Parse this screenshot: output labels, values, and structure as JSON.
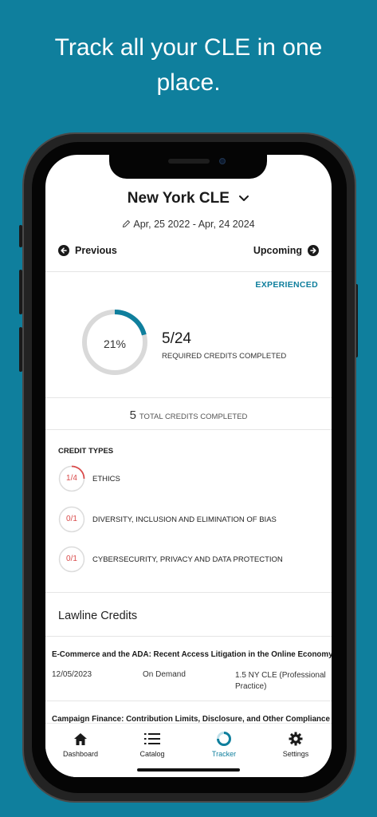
{
  "promo": {
    "line1": "Track all your CLE in one",
    "line2": "place."
  },
  "header": {
    "title": "New York CLE",
    "date_range": "Apr, 25 2022 - Apr, 24 2024",
    "prev_label": "Previous",
    "next_label": "Upcoming"
  },
  "summary": {
    "level": "EXPERIENCED",
    "percent_label": "21%",
    "percent_value": 0.21,
    "required": "5/24",
    "required_label": "REQUIRED CREDITS COMPLETED",
    "total": "5",
    "total_label": "TOTAL CREDITS COMPLETED"
  },
  "credit_types": {
    "heading": "CREDIT TYPES",
    "items": [
      {
        "value": "1/4",
        "fraction": 0.25,
        "name": "ETHICS"
      },
      {
        "value": "0/1",
        "fraction": 0,
        "name": "DIVERSITY, INCLUSION AND ELIMINATION OF BIAS"
      },
      {
        "value": "0/1",
        "fraction": 0,
        "name": "CYBERSECURITY, PRIVACY AND DATA PROTECTION"
      }
    ]
  },
  "lawline": {
    "heading": "Lawline Credits",
    "courses": [
      {
        "title": "E-Commerce and the ADA: Recent Access Litigation in the Online Economy",
        "date": "12/05/2023",
        "mode": "On Demand",
        "credits": "1.5 NY CLE (Professional Practice)"
      },
      {
        "title": "Campaign Finance: Contribution Limits, Disclosure, and Other Compliance"
      }
    ]
  },
  "tabs": [
    {
      "label": "Dashboard",
      "icon": "home-icon"
    },
    {
      "label": "Catalog",
      "icon": "list-icon"
    },
    {
      "label": "Tracker",
      "icon": "tracker-ring-icon"
    },
    {
      "label": "Settings",
      "icon": "gear-icon"
    }
  ],
  "colors": {
    "background": "#0f7f9d",
    "accent": "#0f7f9d",
    "alert": "#d94a4a",
    "ring_track": "#d9d9d9"
  }
}
